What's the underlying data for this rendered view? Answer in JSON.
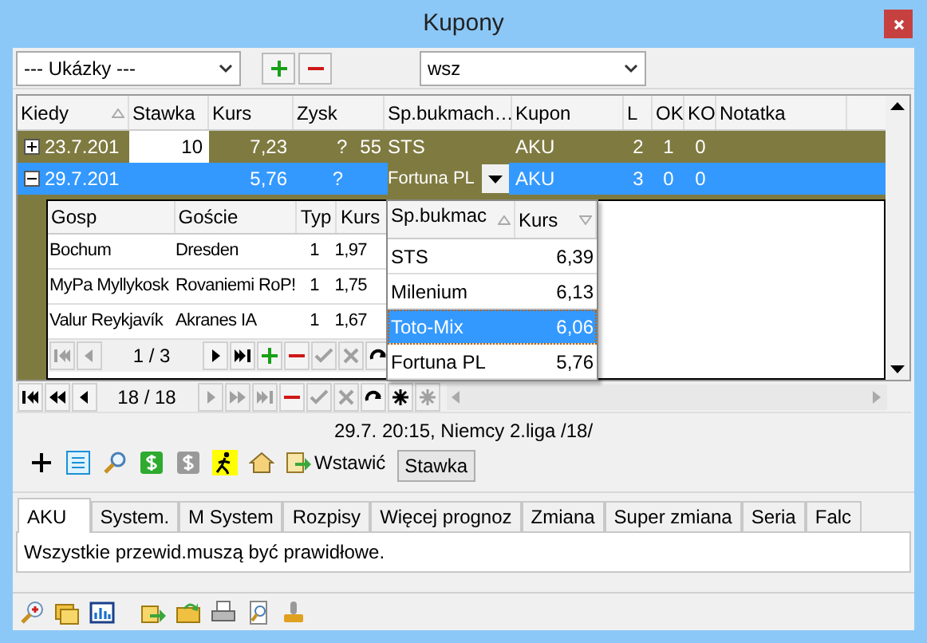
{
  "window": {
    "title": "Kupony"
  },
  "toolbar": {
    "preset_combo": "--- Ukázky ---",
    "filter_combo": "wsz"
  },
  "grid": {
    "columns": [
      {
        "label": "Kiedy",
        "sorted": true
      },
      {
        "label": "Stawka"
      },
      {
        "label": "Kurs"
      },
      {
        "label": "Zysk"
      },
      {
        "label": "Sp.bukmach…"
      },
      {
        "label": "Kupon"
      },
      {
        "label": "L"
      },
      {
        "label": "OK"
      },
      {
        "label": "KO"
      },
      {
        "label": "Notatka"
      }
    ],
    "rows": [
      {
        "expanded": false,
        "selected": false,
        "kiedy": "23.7.201",
        "stawka": "10",
        "kurs": "7,23",
        "zysk": "?",
        "column_extra": "55",
        "bukmacher": "STS",
        "kupon": "AKU",
        "l": "2",
        "ok": "1",
        "ko": "0"
      },
      {
        "expanded": true,
        "selected": true,
        "kiedy": "29.7.201",
        "kurs": "5,76",
        "zysk": "?",
        "bukmacher": "Fortuna PL",
        "kupon": "AKU",
        "l": "3",
        "ok": "0",
        "ko": "0"
      }
    ]
  },
  "detail": {
    "columns": [
      "Gosp",
      "Goście",
      "Typ",
      "Kurs"
    ],
    "rows": [
      {
        "gosp": "Bochum",
        "goscie": "Dresden",
        "typ": "1",
        "kurs": "1,97"
      },
      {
        "gosp": "MyPa Myllykosk",
        "goscie": "Rovaniemi RoP!",
        "typ": "1",
        "kurs": "1,75"
      },
      {
        "gosp": "Valur Reykjavík",
        "goscie": "Akranes IA",
        "typ": "1",
        "kurs": "1,67"
      }
    ],
    "navigator": {
      "position": "1 / 3",
      "buttons": [
        {
          "kind": "first",
          "disabled": true
        },
        {
          "kind": "prior",
          "disabled": true
        },
        {
          "kind": "pos"
        },
        {
          "kind": "next",
          "disabled": false
        },
        {
          "kind": "last",
          "disabled": false
        },
        {
          "kind": "insert",
          "disabled": false
        },
        {
          "kind": "delete",
          "disabled": false
        },
        {
          "kind": "post",
          "disabled": true
        },
        {
          "kind": "cancel",
          "disabled": true
        },
        {
          "kind": "refresh",
          "disabled": false
        }
      ]
    }
  },
  "dropdown": {
    "columns": [
      "Sp.bukmac",
      "Kurs"
    ],
    "items": [
      {
        "name": "STS",
        "kurs": "6,39",
        "selected": false
      },
      {
        "name": "Milenium",
        "kurs": "6,13",
        "selected": false
      },
      {
        "name": "Toto-Mix",
        "kurs": "6,06",
        "selected": true
      },
      {
        "name": "Fortuna PL",
        "kurs": "5,76",
        "selected": false
      }
    ]
  },
  "navigator": {
    "position": "18 / 18",
    "buttons": [
      {
        "kind": "first",
        "disabled": false
      },
      {
        "kind": "priorpage",
        "disabled": false
      },
      {
        "kind": "prior",
        "disabled": false
      },
      {
        "kind": "pos"
      },
      {
        "kind": "next",
        "disabled": true
      },
      {
        "kind": "nextpage",
        "disabled": true
      },
      {
        "kind": "last",
        "disabled": true
      },
      {
        "kind": "delete",
        "disabled": false
      },
      {
        "kind": "post",
        "disabled": true
      },
      {
        "kind": "cancel",
        "disabled": true
      },
      {
        "kind": "refresh",
        "disabled": false
      },
      {
        "kind": "star",
        "disabled": false
      },
      {
        "kind": "star",
        "disabled": true
      }
    ]
  },
  "status_text": "29.7. 20:15, Niemcy 2.liga /18/",
  "actions": {
    "insert_label": "Wstawić",
    "stake_button": "Stawka"
  },
  "tabs": [
    {
      "label": "AKU",
      "selected": true
    },
    {
      "label": "System.",
      "selected": false
    },
    {
      "label": "M System",
      "selected": false
    },
    {
      "label": "Rozpisy",
      "selected": false
    },
    {
      "label": "Więcej prognoz",
      "selected": false
    },
    {
      "label": "Zmiana",
      "selected": false
    },
    {
      "label": "Super zmiana",
      "selected": false
    },
    {
      "label": "Seria",
      "selected": false
    },
    {
      "label": "Falc",
      "selected": false
    }
  ],
  "tab_content": "Wszystkie przewid.muszą być prawidłowe."
}
